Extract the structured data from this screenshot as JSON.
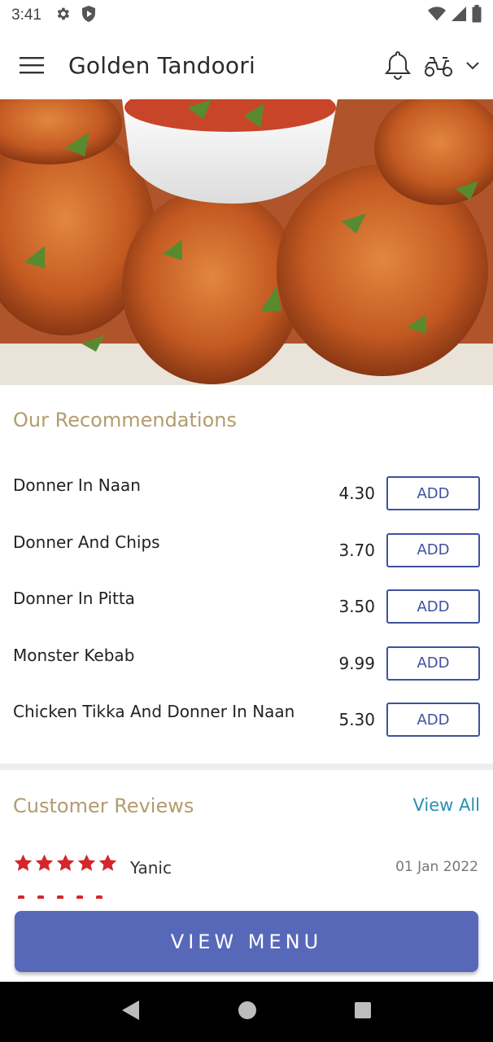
{
  "status_bar": {
    "time": "3:41",
    "icons": [
      "settings-gear-icon",
      "shield-play-icon",
      "wifi-icon",
      "cellular-signal-icon",
      "battery-icon"
    ]
  },
  "app_bar": {
    "title": "Golden Tandoori",
    "icons": [
      "hamburger-menu-icon",
      "notification-bell-icon",
      "delivery-scooter-icon",
      "chevron-down-icon"
    ]
  },
  "hero": {
    "image_alt": "Tandoori chicken with dipping sauce"
  },
  "recommendations": {
    "title": "Our Recommendations",
    "add_label": "ADD",
    "items": [
      {
        "name": "Donner In Naan",
        "price": "4.30"
      },
      {
        "name": "Donner And Chips",
        "price": "3.70"
      },
      {
        "name": "Donner In Pitta",
        "price": "3.50"
      },
      {
        "name": "Monster Kebab",
        "price": "9.99"
      },
      {
        "name": "Chicken Tikka And Donner In Naan",
        "price": "5.30"
      }
    ]
  },
  "reviews": {
    "title": "Customer Reviews",
    "view_all": "View All",
    "items": [
      {
        "reviewer": "Yanic",
        "date": "01 Jan 2022",
        "rating": 5
      }
    ]
  },
  "cta": {
    "label": "VIEW MENU"
  },
  "colors": {
    "accent": "#5868b9",
    "section_title": "#b39c6e",
    "link": "#2b8fb0",
    "star": "#d4262b",
    "add_button": "#3f51a0"
  },
  "nav_bar": {
    "icons": [
      "back-triangle-icon",
      "home-circle-icon",
      "recents-square-icon"
    ]
  }
}
